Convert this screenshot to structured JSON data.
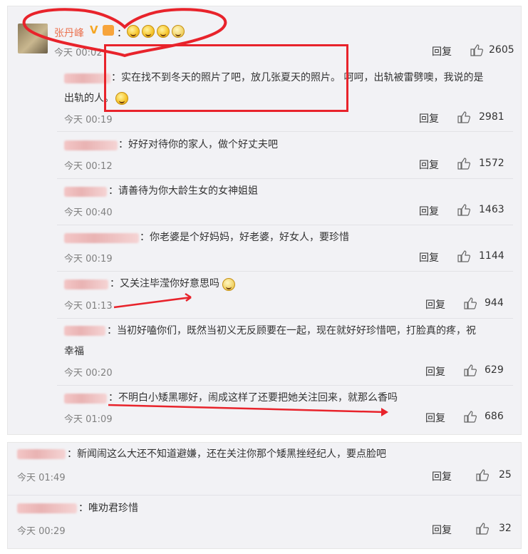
{
  "top_comment": {
    "author": "张丹峰",
    "badge_v": "V",
    "level_badge": "",
    "colon": "：",
    "emojis": [
      "laugh-emoji",
      "laugh-emoji",
      "cry-laugh-emoji",
      "dizzy-emoji"
    ],
    "time": "今天 00:02",
    "reply_label": "回复",
    "likes": "2605"
  },
  "replies": [
    {
      "text_line1": "：实在找不到冬天的照片了吧，放几张夏天的照片。 呵呵，出轨被雷劈噢，我说的是",
      "text_line2": "出轨的人。",
      "time": "今天 00:19",
      "reply_label": "回复",
      "likes": "2981"
    },
    {
      "text": "：好好对待你的家人，做个好丈夫吧",
      "time": "今天 00:12",
      "reply_label": "回复",
      "likes": "1572"
    },
    {
      "text": "：请善待为你大龄生女的女神姐姐",
      "time": "今天 00:40",
      "reply_label": "回复",
      "likes": "1463"
    },
    {
      "text": "：你老婆是个好妈妈，好老婆，好女人，要珍惜",
      "time": "今天 00:19",
      "reply_label": "回复",
      "likes": "1144"
    },
    {
      "text": "：又关注毕滢你好意思吗",
      "time": "今天 01:13",
      "reply_label": "回复",
      "likes": "944"
    },
    {
      "text_line1": "：当初好嗑你们，既然当初义无反顾要在一起，现在就好好珍惜吧，打脸真的疼，祝",
      "text_line2": "幸福",
      "time": "今天 00:20",
      "reply_label": "回复",
      "likes": "629"
    },
    {
      "text": "：不明白小矮黑哪好，闹成这样了还要把她关注回来，就那么香吗",
      "time": "今天 01:09",
      "reply_label": "回复",
      "likes": "686"
    }
  ],
  "bottom_comments": [
    {
      "text": "：新闻闹这么大还不知道避嫌，还在关注你那个矮黑挫经纪人，要点脸吧",
      "time": "今天 01:49",
      "reply_label": "回复",
      "likes": "25"
    },
    {
      "text": "：唯劝君珍惜",
      "time": "今天 00:29",
      "reply_label": "回复",
      "likes": "32"
    }
  ],
  "colors": {
    "name": "#eb7350",
    "annotation_red": "#e8232b",
    "panel_bg": "#f2f2f5",
    "blur_pink": "#efc0c0"
  }
}
